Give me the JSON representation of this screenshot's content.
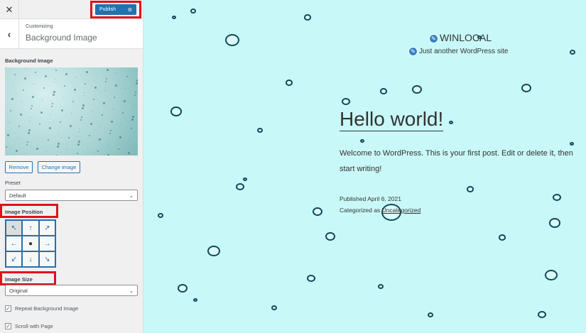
{
  "sidebar": {
    "close_icon": "close-icon",
    "publish_label": "Publish",
    "gear_icon": "gear-icon",
    "header_sub": "Customizing",
    "header_title": "Background Image",
    "bg_image_label": "Background Image",
    "remove_label": "Remove",
    "change_label": "Change image",
    "preset_label": "Preset",
    "preset_value": "Default",
    "position_label": "Image Position",
    "position_arrows": [
      "↖",
      "↑",
      "↗",
      "←",
      "●",
      "→",
      "↙",
      "↓",
      "↘"
    ],
    "size_label": "Image Size",
    "size_value": "Original",
    "repeat_label": "Repeat Background Image",
    "repeat_checked": true,
    "scroll_label": "Scroll with Page",
    "scroll_checked": true
  },
  "preview": {
    "site_title": "WINLOCAL",
    "tagline": "Just another WordPress site",
    "post_title": "Hello world!",
    "post_body": "Welcome to WordPress. This is your first post. Edit or delete it, then start writing!",
    "published": "Published April 6, 2021",
    "categorized_prefix": "Categorized as",
    "category": "Uncategorized"
  }
}
